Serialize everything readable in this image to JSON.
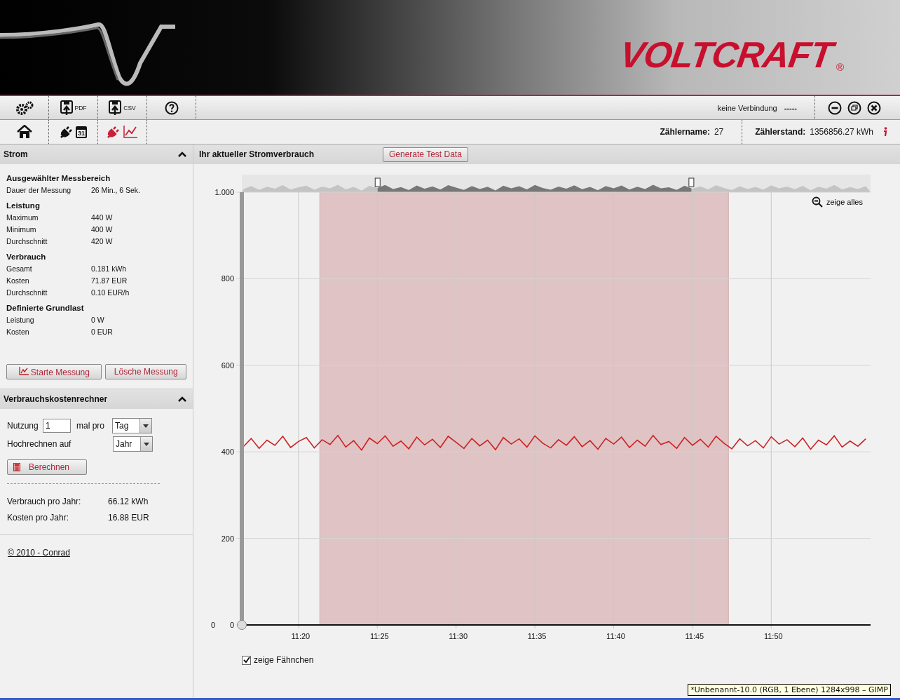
{
  "header": {
    "logo": "VOLTCRAFT",
    "trademark": "®"
  },
  "toolbar": {
    "buttons": [
      {
        "kind": "settings"
      },
      {
        "kind": "pdf",
        "label": "PDF"
      },
      {
        "kind": "csv",
        "label": "CSV"
      },
      {
        "kind": "help"
      }
    ],
    "status": "keine Verbindung",
    "status_value": "-----",
    "window_buttons": [
      {
        "kind": "minimize"
      },
      {
        "kind": "restore"
      },
      {
        "kind": "close"
      }
    ]
  },
  "viewbar": {
    "views": [
      {
        "kind": "home",
        "selected": false
      },
      {
        "kind": "calendar",
        "calendar_day": "31",
        "selected": false
      },
      {
        "kind": "live",
        "selected": true
      }
    ],
    "meter_name_label": "Zählername:",
    "meter_name": "27",
    "meter_reading_label": "Zählerstand:",
    "meter_reading": "1356856.27 kWh"
  },
  "strom_panel": {
    "title": "Strom",
    "expanded": true,
    "groups": [
      {
        "heading": "Ausgewählter Messbereich",
        "rows": [
          {
            "label": "Dauer der Messung",
            "value": "26 Min., 6 Sek."
          }
        ]
      },
      {
        "heading": "Leistung",
        "rows": [
          {
            "label": "Maximum",
            "value": "440 W"
          },
          {
            "label": "Minimum",
            "value": "400 W"
          },
          {
            "label": "Durchschnitt",
            "value": "420 W"
          }
        ]
      },
      {
        "heading": "Verbrauch",
        "rows": [
          {
            "label": "Gesamt",
            "value": "0.181 kWh"
          },
          {
            "label": "Kosten",
            "value": "71.87 EUR"
          },
          {
            "label": "Durchschnitt",
            "value": "0.10 EUR/h"
          }
        ]
      },
      {
        "heading": "Definierte Grundlast",
        "rows": [
          {
            "label": "Leistung",
            "value": "0 W"
          },
          {
            "label": "Kosten",
            "value": "0 EUR"
          }
        ]
      }
    ],
    "buttons": [
      {
        "kind": "chart",
        "label": "Starte Messung"
      },
      {
        "kind": "plain",
        "label": "Lösche Messung"
      }
    ]
  },
  "calculator_panel": {
    "title": "Verbrauchskostenrechner",
    "expanded": true,
    "usage_label": "Nutzung",
    "usage_value": "1",
    "per_label": "mal pro",
    "per_select": "Tag",
    "project_label": "Hochrechnen auf",
    "project_select": "Jahr",
    "button": "Berechnen",
    "results": [
      {
        "label": "Verbrauch pro Jahr:",
        "value": "66.12 kWh"
      },
      {
        "label": "Kosten pro Jahr:",
        "value": "16.88 EUR"
      }
    ]
  },
  "footer_link": "© 2010 - Conrad",
  "chart_panel": {
    "title": "Ihr aktueller Stromverbrauch",
    "button": "Generate Test Data",
    "zoom_reset": "zeige alles",
    "extra_axis_label": "0",
    "top_axis_label": "1.000",
    "show_flags": {
      "label": "zeige Fähnchen",
      "checked": true
    },
    "chart_data": {
      "type": "line",
      "ylim": [
        0,
        1000
      ],
      "yticks": [
        0,
        200,
        400,
        600,
        800
      ],
      "categories": [
        null,
        null,
        null,
        null,
        null,
        null,
        null,
        "11:20",
        null,
        null,
        null,
        null,
        null,
        null,
        null,
        null,
        null,
        "11:25",
        null,
        null,
        null,
        null,
        null,
        null,
        null,
        null,
        null,
        "11:30",
        null,
        null,
        null,
        null,
        null,
        null,
        null,
        null,
        null,
        "11:35",
        null,
        null,
        null,
        null,
        null,
        null,
        null,
        null,
        null,
        "11:40",
        null,
        null,
        null,
        null,
        null,
        null,
        null,
        null,
        null,
        "11:45",
        null,
        null,
        null,
        null,
        null,
        null,
        null,
        null,
        null,
        "11:50",
        null,
        null,
        null,
        null,
        null,
        null,
        null,
        null,
        null,
        null,
        null,
        null
      ],
      "series": [
        {
          "color": "#cc2222",
          "values": [
            412,
            431,
            408,
            427,
            415,
            436,
            410,
            424,
            433,
            409,
            428,
            417,
            438,
            411,
            426,
            404,
            432,
            419,
            437,
            413,
            425,
            407,
            434,
            416,
            429,
            410,
            436,
            422,
            408,
            431,
            414,
            427,
            405,
            433,
            418,
            430,
            411,
            437,
            420,
            409,
            428,
            415,
            435,
            412,
            426,
            406,
            431,
            418,
            434,
            410,
            427,
            413,
            438,
            417,
            424,
            408,
            433,
            415,
            429,
            411,
            436,
            420,
            407,
            430,
            414,
            426,
            409,
            435,
            418,
            428,
            412,
            432,
            406,
            427,
            416,
            437,
            411,
            425,
            413,
            430
          ]
        }
      ],
      "grid": true
    },
    "selection": {
      "edges": [
        {
          "level": 0.124
        },
        {
          "level": 0.774
        }
      ]
    },
    "y_range_slider": {
      "level": 1
    },
    "navigator": {
      "handles": [
        {
          "level": 0.216
        },
        {
          "level": 0.715
        }
      ]
    }
  },
  "os_tooltip": "*Unbenannt-10.0 (RGB, 1 Ebene) 1284x998 – GIMP"
}
